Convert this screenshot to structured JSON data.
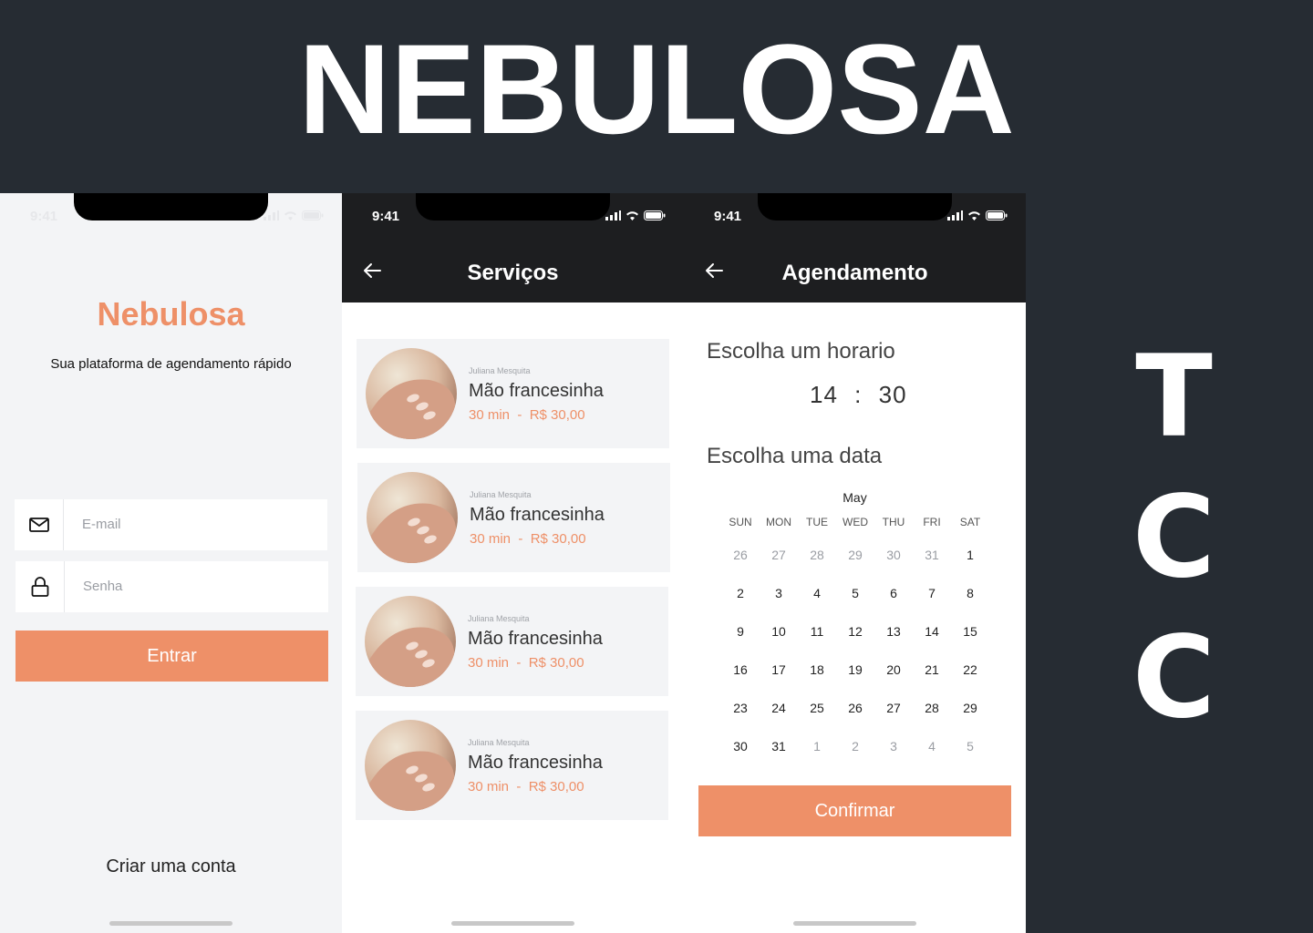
{
  "banner": {
    "title": "NEBULOSA",
    "side_letters": [
      "T",
      "C",
      "C"
    ]
  },
  "colors": {
    "accent": "#ee9068",
    "dark": "#1d1e20",
    "background": "#262c33"
  },
  "login_screen": {
    "status_time": "9:41",
    "brand": "Nebulosa",
    "tagline": "Sua plataforma de agendamento rápido",
    "email_placeholder": "E-mail",
    "password_placeholder": "Senha",
    "login_button": "Entrar",
    "create_account": "Criar uma conta",
    "email_icon": "mail-icon",
    "password_icon": "lock-icon"
  },
  "services_screen": {
    "status_time": "9:41",
    "title": "Serviços",
    "back_icon": "arrow-left-icon",
    "services": [
      {
        "provider": "Juliana Mesquita",
        "name": "Mão francesinha",
        "duration": "30 min",
        "price": "R$ 30,00"
      },
      {
        "provider": "Juliana Mesquita",
        "name": "Mão francesinha",
        "duration": "30 min",
        "price": "R$ 30,00"
      },
      {
        "provider": "Juliana Mesquita",
        "name": "Mão francesinha",
        "duration": "30 min",
        "price": "R$ 30,00"
      },
      {
        "provider": "Juliana Mesquita",
        "name": "Mão francesinha",
        "duration": "30 min",
        "price": "R$ 30,00"
      }
    ]
  },
  "schedule_screen": {
    "status_time": "9:41",
    "title": "Agendamento",
    "back_icon": "arrow-left-icon",
    "time_heading": "Escolha um horario",
    "hour": "14",
    "time_separator": ":",
    "minute": "30",
    "date_heading": "Escolha uma data",
    "month": "May",
    "weekdays": [
      "SUN",
      "MON",
      "TUE",
      "WED",
      "THU",
      "FRI",
      "SAT"
    ],
    "weeks": [
      [
        "26",
        "27",
        "28",
        "29",
        "30",
        "31",
        "1"
      ],
      [
        "2",
        "3",
        "4",
        "5",
        "6",
        "7",
        "8"
      ],
      [
        "9",
        "10",
        "11",
        "12",
        "13",
        "14",
        "15"
      ],
      [
        "16",
        "17",
        "18",
        "19",
        "20",
        "21",
        "22"
      ],
      [
        "23",
        "24",
        "25",
        "26",
        "27",
        "28",
        "29"
      ],
      [
        "30",
        "31",
        "1",
        "2",
        "3",
        "4",
        "5"
      ]
    ],
    "confirm_button": "Confirmar"
  }
}
